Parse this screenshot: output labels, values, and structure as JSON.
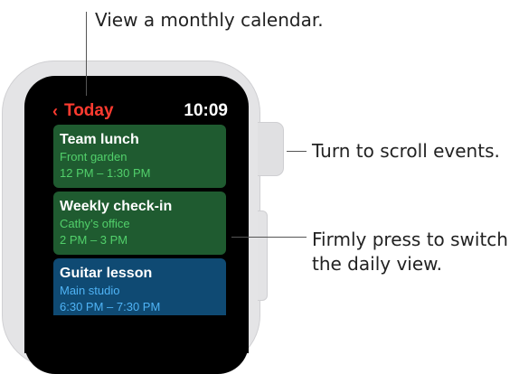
{
  "callouts": {
    "calendar": "View a monthly calendar.",
    "scroll": "Turn to scroll events.",
    "press_line1": "Firmly press to switch",
    "press_line2": "the daily view."
  },
  "watch": {
    "back_label": "Today",
    "back_icon": "chevron-left-icon",
    "time": "10:09",
    "events": [
      {
        "title": "Team lunch",
        "location": "Front garden",
        "time": "12 PM – 1:30 PM",
        "color": "#1f5b30"
      },
      {
        "title": "Weekly check-in",
        "location": "Cathy’s office",
        "time": "2 PM – 3 PM",
        "color": "#1f5b30"
      },
      {
        "title": "Guitar lesson",
        "location": "Main studio",
        "time": "6:30 PM – 7:30 PM",
        "color": "#0f4a73"
      }
    ]
  },
  "colors": {
    "accent_red": "#ff3b30",
    "event_green_text": "#52d06b",
    "event_blue_text": "#4fb3f5"
  }
}
